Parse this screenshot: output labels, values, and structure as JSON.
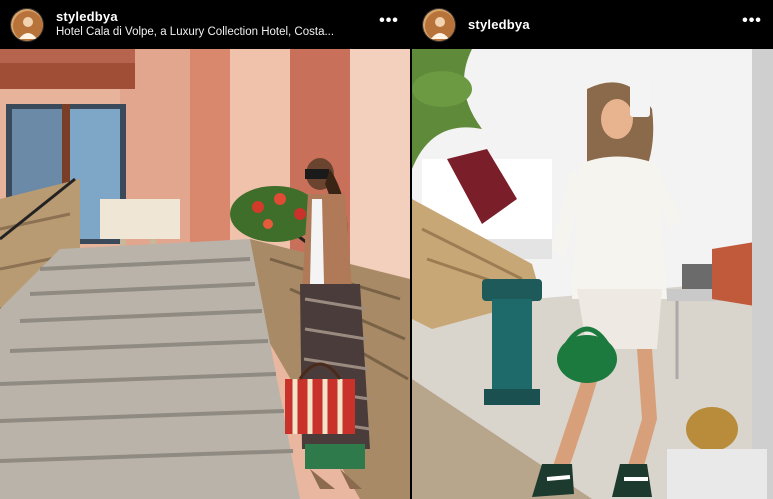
{
  "posts": [
    {
      "username": "styledbya",
      "location": "Hotel Cala di Volpe, a Luxury Collection Hotel, Costa...",
      "more_icon": "more-horizontal-icon",
      "photo_icon": "photo-woman-on-stairs"
    },
    {
      "username": "styledbya",
      "location": "",
      "more_icon": "more-horizontal-icon",
      "photo_icon": "photo-mirror-selfie"
    }
  ],
  "more_label": "•••",
  "colors": {
    "background": "#000000",
    "text": "#ffffff",
    "avatar_ring": "#c98a4a"
  }
}
